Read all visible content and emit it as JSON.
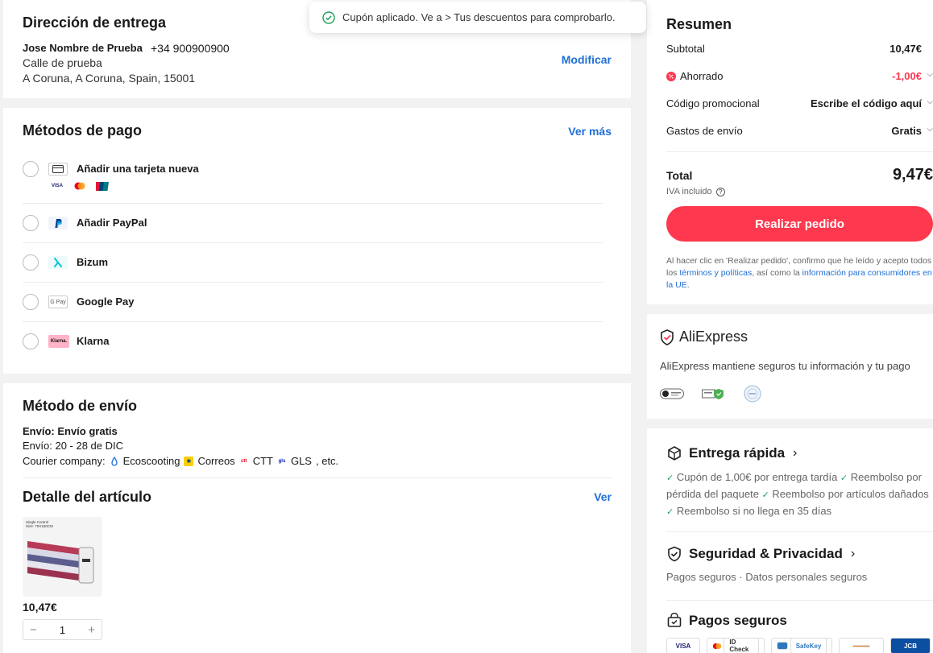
{
  "toast": {
    "text": "Cupón aplicado. Ve a > Tus descuentos para comprobarlo."
  },
  "address": {
    "title": "Dirección de entrega",
    "name": "Jose Nombre de Prueba",
    "phone": "+34 900900900",
    "line1": "Calle de prueba",
    "line2": "A Coruna, A Coruna, Spain, 15001",
    "modify_label": "Modificar"
  },
  "payment": {
    "title": "Métodos de pago",
    "see_more_label": "Ver más",
    "methods": [
      {
        "label": "Añadir una tarjeta nueva",
        "icon": "credit-card-icon"
      },
      {
        "label": "Añadir PayPal",
        "icon": "paypal-icon"
      },
      {
        "label": "Bizum",
        "icon": "bizum-icon"
      },
      {
        "label": "Google Pay",
        "icon": "google-pay-icon"
      },
      {
        "label": "Klarna",
        "icon": "klarna-icon"
      }
    ],
    "card_brands": [
      "VISA",
      "Mastercard",
      "UnionPay"
    ],
    "icon_text": {
      "gpay": "G Pay",
      "klarna": "Klarna."
    }
  },
  "shipping": {
    "title": "Método de envío",
    "method": "Envío: Envío gratis",
    "dates": "Envío: 20 - 28 de DIC",
    "courier_label": "Courier company:",
    "couriers": [
      "Ecoscooting",
      "Correos",
      "CTT",
      "GLS"
    ],
    "courier_suffix": ", etc."
  },
  "item": {
    "title": "Detalle del artículo",
    "see_label": "Ver",
    "image_caption": "Single Control\nSize: 70X150CM",
    "price": "10,47€",
    "quantity": "1",
    "minus": "−",
    "plus": "+"
  },
  "summary": {
    "title": "Resumen",
    "subtotal_label": "Subtotal",
    "subtotal_value": "10,47€",
    "saved_label": "Ahorrado",
    "saved_value": "-1,00€",
    "promo_label": "Código promocional",
    "promo_value": "Escribe el código aquí",
    "shipping_label": "Gastos de envío",
    "shipping_value": "Gratis",
    "total_label": "Total",
    "total_value": "9,47€",
    "vat_label": "IVA incluido",
    "order_button": "Realizar pedido",
    "legal_prefix": "Al hacer clic en 'Realizar pedido', confirmo que he leído y acepto todos los ",
    "legal_link1": "términos y políticas",
    "legal_mid": ", así como la ",
    "legal_link2": "información para consumidores en la UE",
    "legal_suffix": ".",
    "accent_color": "#fd384f"
  },
  "aliexpress": {
    "brand": "AliExpress",
    "description": "AliExpress mantiene seguros tu información y tu pago"
  },
  "benefits": {
    "fast_title": "Entrega rápida",
    "fast_items": [
      "Cupón de 1,00€ por entrega tardía",
      "Reembolso por pérdida del paquete",
      "Reembolso por artículos dañados",
      "Reembolso si no llega en 35 días"
    ],
    "security_title": "Seguridad & Privacidad",
    "security_desc": "Pagos seguros · Datos personales seguros",
    "payments_title": "Pagos seguros",
    "payment_marks": [
      "VISA",
      "ID Check",
      "SafeKey",
      "",
      "JCB"
    ]
  }
}
